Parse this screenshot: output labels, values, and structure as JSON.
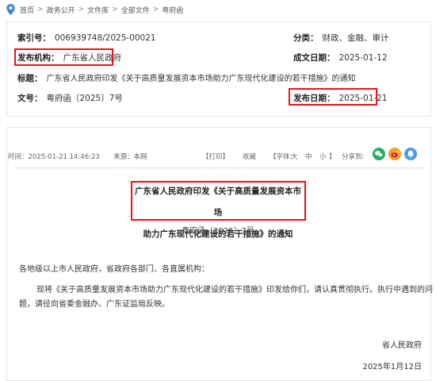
{
  "breadcrumb": {
    "items": [
      "首页",
      "政务公开",
      "文件库",
      "全部文件",
      "粤府函"
    ],
    "separator": ">"
  },
  "meta": {
    "index_label": "索引号：",
    "index_value": "006939748/2025-00021",
    "category_label": "分类：",
    "category_value": "财政、金融、审计",
    "issuer_label": "发布机构：",
    "issuer_value": "广东省人民政府",
    "created_label": "成文日期：",
    "created_value": "2025-01-12",
    "title_label": "标题：",
    "title_value": "广东省人民政府印发《关于高质量发展资本市场助力广东现代化建设的若干措施》的通知",
    "docno_label": "文号：",
    "docno_value": "粤府函〔2025〕7号",
    "published_label": "发布日期：",
    "published_value": "2025-01-21"
  },
  "toolbar": {
    "time": "时间：2025-01-21 14:46:23",
    "source": "来源：本网",
    "print": "【打印】",
    "favorite": "收藏",
    "font_label": "【字体:",
    "font_large": "大",
    "font_medium": "中",
    "font_small": "小",
    "font_close": "】",
    "share": "分享到:"
  },
  "share_icons": [
    {
      "name": "wechat-icon",
      "color": "#2aae67"
    },
    {
      "name": "weibo-icon",
      "color": "#e6162d"
    },
    {
      "name": "bell-icon",
      "color": "#4a9be8"
    }
  ],
  "article": {
    "title_line1": "广东省人民政府印发《关于高质量发展资本市场",
    "title_line2": "助力广东现代化建设的若干措施》的通知",
    "doc_no": "粤府函〔2025〕7号",
    "salutation": "各地级以上市人民政府，省政府各部门、各直属机构：",
    "body_line1": "现将《关于高质量发展资本市场助力广东现代化建设的若干措施》印发给你们，请认真贯彻执行。执行中遇到的问",
    "body_line2": "题，请径向省委金融办、广东证监局反映。",
    "signature": "省人民政府",
    "date": "2025年1月12日"
  },
  "colors": {
    "highlight": "#e8141c",
    "border": "#e6e6e6",
    "pin": "#3a86d6"
  }
}
